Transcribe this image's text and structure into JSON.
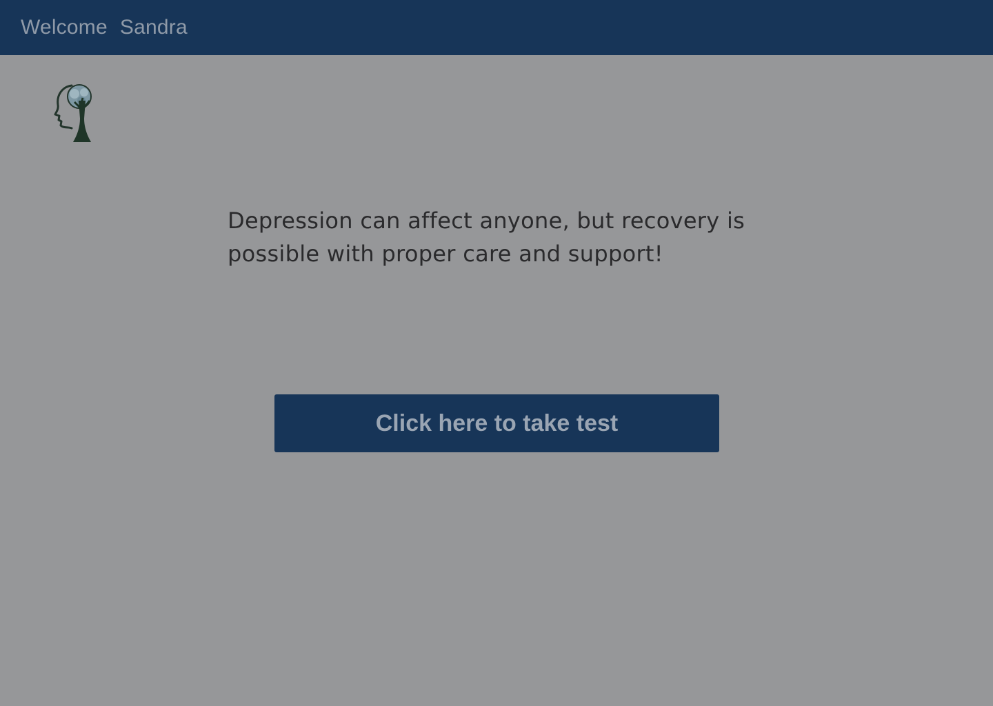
{
  "header": {
    "welcome_label": "Welcome",
    "user_name": "Sandra"
  },
  "logo": {
    "icon": "head-tree-icon"
  },
  "main": {
    "message": "Depression can affect anyone, but recovery is possible with proper care and support!",
    "cta_label": "Click here to take test"
  },
  "colors": {
    "header_bg": "#173558",
    "page_bg": "#969799",
    "button_bg": "#173558",
    "text": "#2a2a2c"
  }
}
